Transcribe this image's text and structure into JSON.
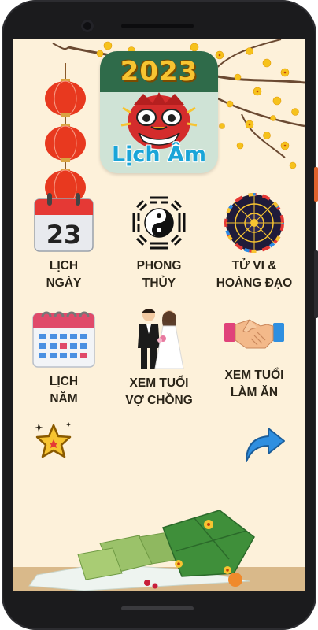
{
  "app": {
    "year": "2023",
    "name": "Lịch Âm"
  },
  "menu": [
    {
      "label": "LỊCH\nNGÀY",
      "icon": "calendar-day-icon",
      "day_number": "23"
    },
    {
      "label": "PHONG\nTHỦY",
      "icon": "bagua-icon"
    },
    {
      "label": "TỬ VI &\nHOÀNG ĐẠO",
      "icon": "zodiac-wheel-icon"
    },
    {
      "label": "LỊCH\nNĂM",
      "icon": "calendar-year-icon"
    },
    {
      "label": "XEM TUỔI\nVỢ CHỒNG",
      "icon": "wedding-couple-icon"
    },
    {
      "label": "XEM TUỔI\nLÀM ĂN",
      "icon": "handshake-icon"
    }
  ],
  "actions": {
    "favorite_icon": "star-icon",
    "share_icon": "share-arrow-icon"
  },
  "colors": {
    "background": "#fdf1da",
    "logo_green": "#2f6b4a",
    "year_gold": "#f7c431",
    "app_name_blue": "#1aa5d8",
    "lantern_red": "#e8391f",
    "label_text": "#2a2418"
  }
}
